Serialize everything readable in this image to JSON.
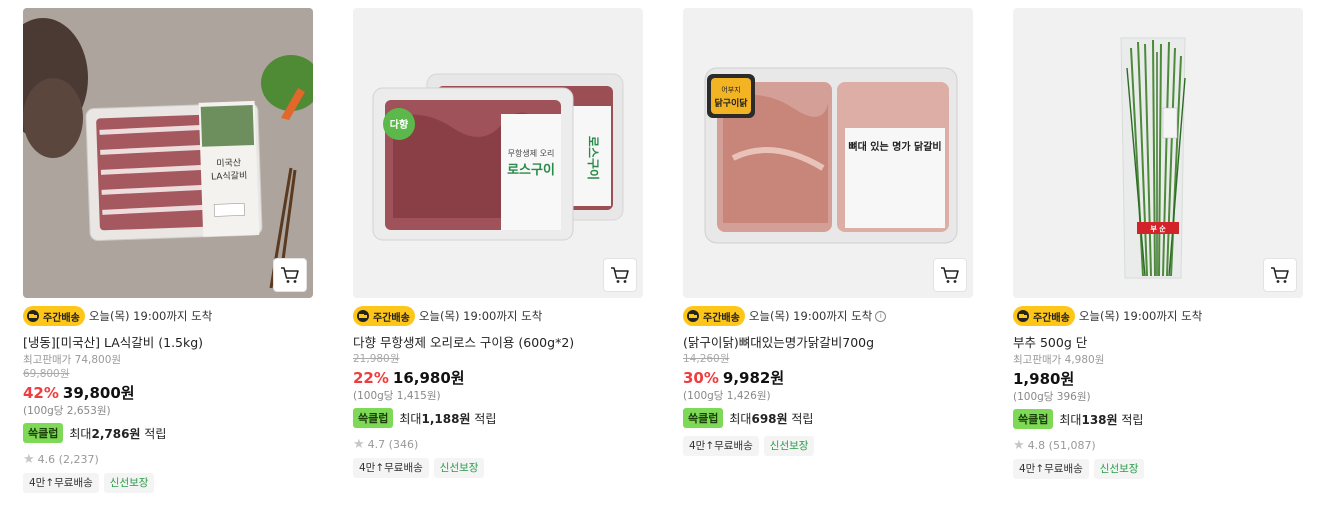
{
  "products": [
    {
      "delivery_badge": "주간배송",
      "arrival": "오늘(목) 19:00까지 도착",
      "name": "[냉동][미국산] LA식갈비 (1.5kg)",
      "max_price": "최고판매가 74,800원",
      "original_price": "69,800원",
      "discount": "42%",
      "price": "39,800원",
      "unit_price": "(100g당 2,653원)",
      "reward_badge": "쓱클럽",
      "reward_prefix": "최대",
      "reward_amount": "2,786원",
      "reward_suffix": " 적립",
      "rating": "4.6",
      "reviews": "(2,237)",
      "tag_shipping": "4만↑무료배송",
      "tag_fresh": "신선보장"
    },
    {
      "delivery_badge": "주간배송",
      "arrival": "오늘(목) 19:00까지 도착",
      "name": "다향 무항생제 오리로스 구이용 (600g*2)",
      "original_price": "21,980원",
      "discount": "22%",
      "price": "16,980원",
      "unit_price": "(100g당 1,415원)",
      "reward_badge": "쓱클럽",
      "reward_prefix": "최대",
      "reward_amount": "1,188원",
      "reward_suffix": " 적립",
      "rating": "4.7",
      "reviews": "(346)",
      "tag_shipping": "4만↑무료배송",
      "tag_fresh": "신선보장"
    },
    {
      "delivery_badge": "주간배송",
      "arrival": "오늘(목) 19:00까지 도착",
      "info_icon": "info-icon",
      "name": "(닭구이닭)뼈대있는명가닭갈비700g",
      "original_price": "14,260원",
      "discount": "30%",
      "price": "9,982원",
      "unit_price": "(100g당 1,426원)",
      "reward_badge": "쓱클럽",
      "reward_prefix": "최대",
      "reward_amount": "698원",
      "reward_suffix": " 적립",
      "tag_shipping": "4만↑무료배송",
      "tag_fresh": "신선보장"
    },
    {
      "delivery_badge": "주간배송",
      "arrival": "오늘(목) 19:00까지 도착",
      "name": "부추 500g 단",
      "max_price": "최고판매가 4,980원",
      "price": "1,980원",
      "unit_price": "(100g당 396원)",
      "reward_badge": "쓱클럽",
      "reward_prefix": "최대",
      "reward_amount": "138원",
      "reward_suffix": " 적립",
      "rating": "4.8",
      "reviews": "(51,087)",
      "tag_shipping": "4만↑무료배송",
      "tag_fresh": "신선보장"
    }
  ],
  "images": {
    "p0_label_line1": "미국산",
    "p0_label_line2": "LA식갈비",
    "p1_logo": "다향",
    "p1_label_small": "무항생제 오리",
    "p1_label_big": "로스구이",
    "p1_label_suffix": "용",
    "p2_logo_top": "어부지",
    "p2_logo_main": "닭구이닭",
    "p2_label": "뼈대 있는 명가 닭갈비",
    "p3_band": "부 순"
  },
  "colors": {
    "discount": "#f03c3c",
    "reward_badge_bg": "#7ed957",
    "delivery_badge_bg": "#ffc61a",
    "fresh_tag": "#2a9d4a"
  },
  "icons": {
    "cart": "cart-icon",
    "truck": "truck-icon",
    "star": "star-icon"
  }
}
